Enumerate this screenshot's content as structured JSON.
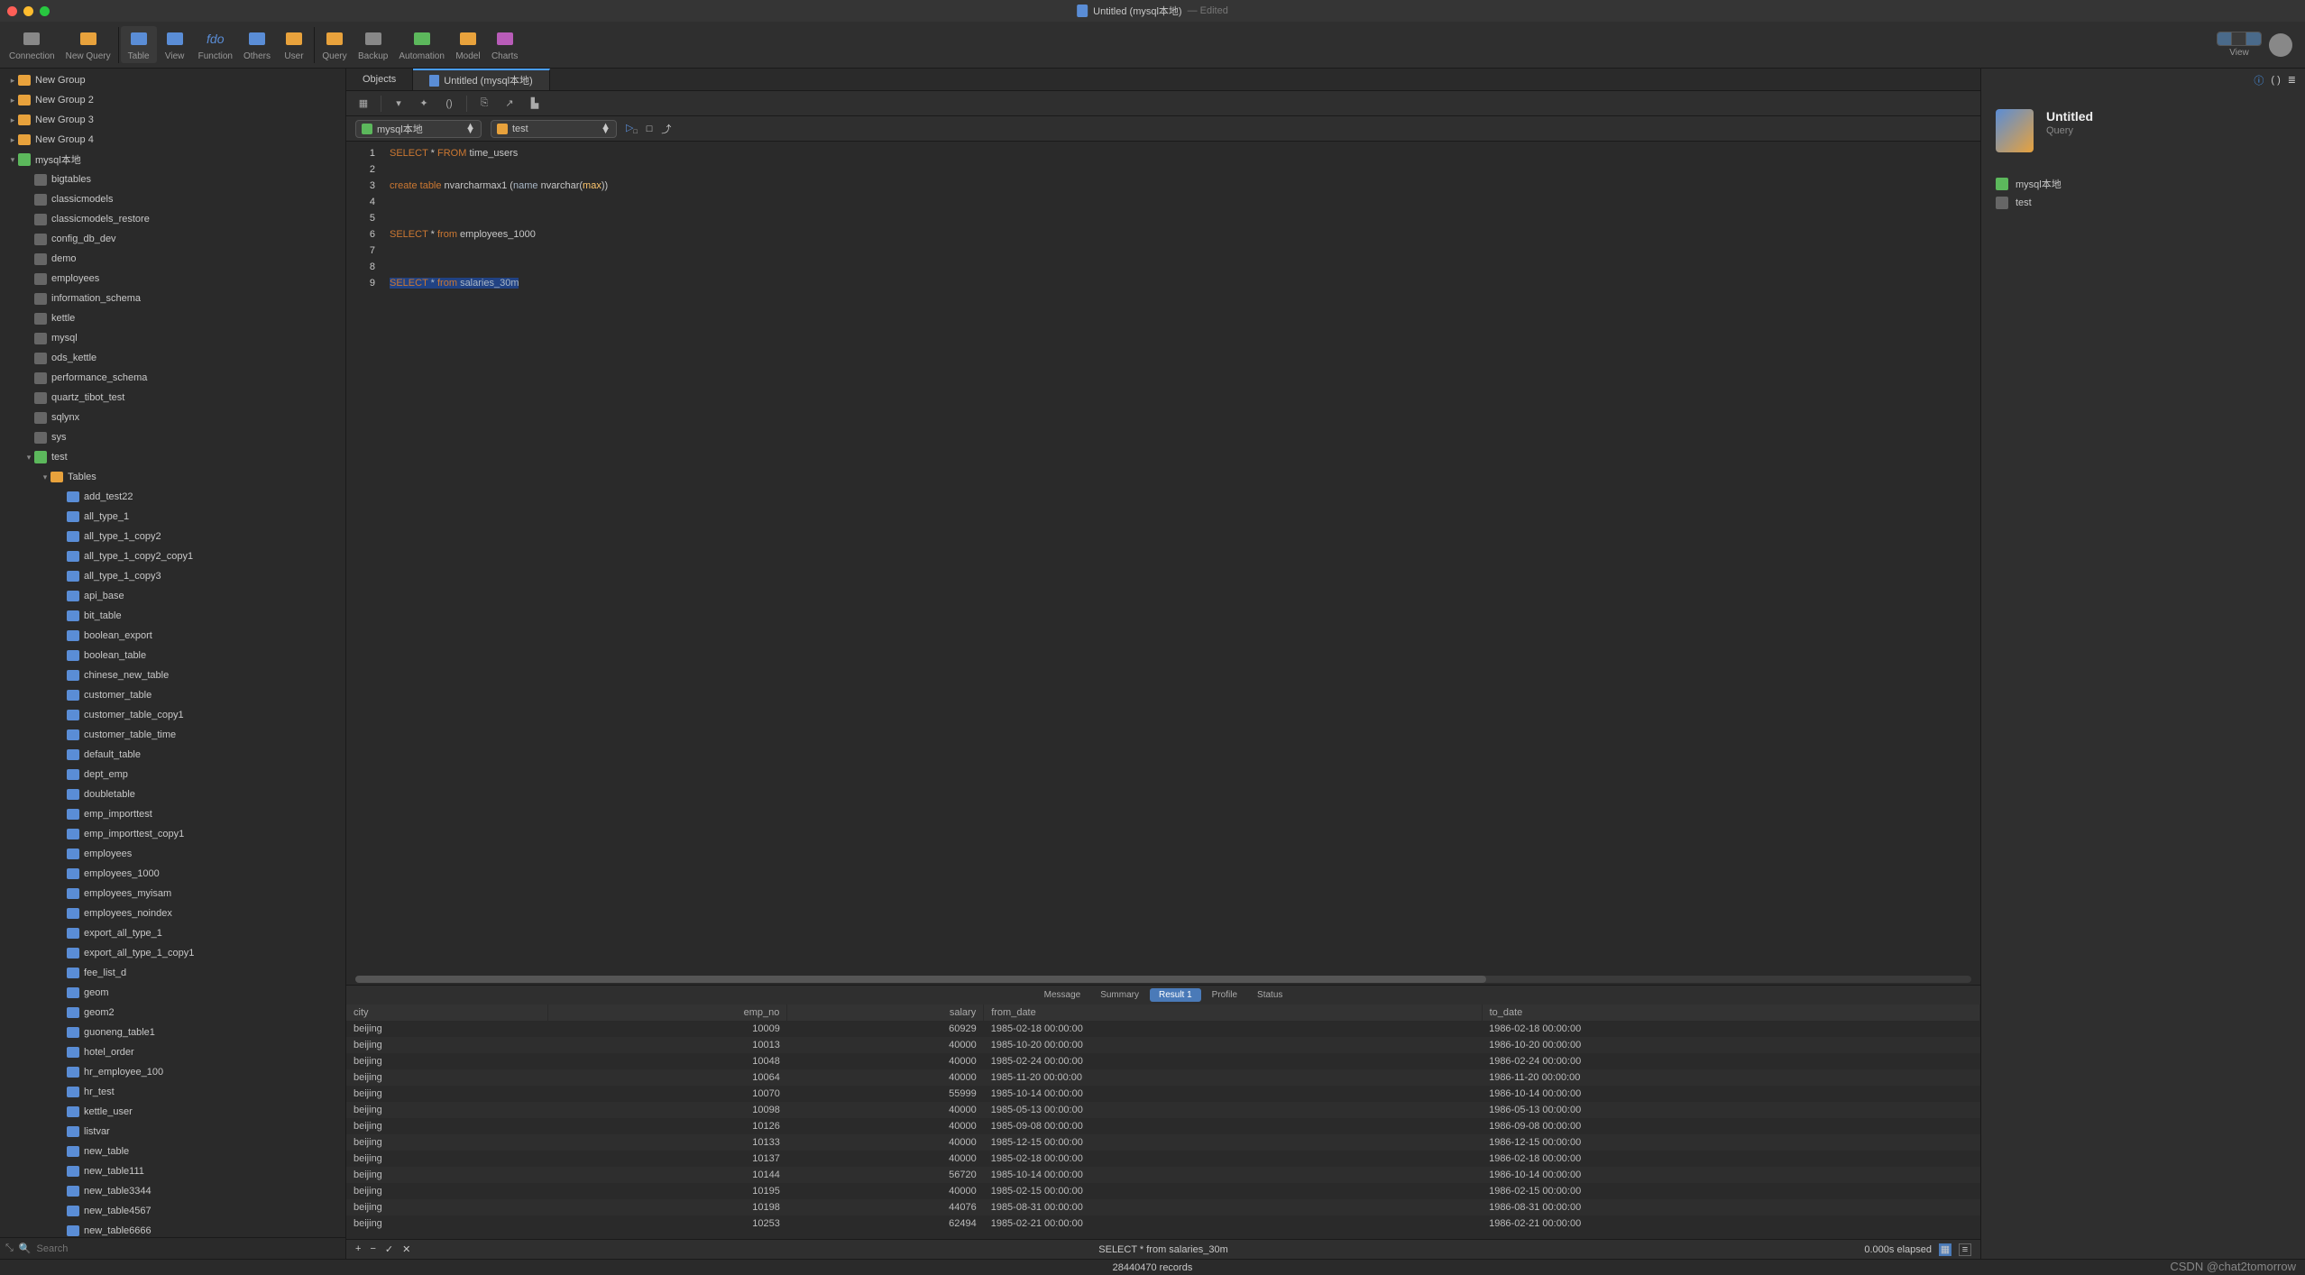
{
  "titlebar": {
    "doc_title": "Untitled (mysql本地)",
    "edited": "— Edited"
  },
  "toolbar": {
    "items": [
      {
        "id": "connection",
        "label": "Connection"
      },
      {
        "id": "new-query",
        "label": "New Query"
      },
      {
        "id": "table",
        "label": "Table",
        "active": true
      },
      {
        "id": "view",
        "label": "View"
      },
      {
        "id": "function",
        "label": "Function"
      },
      {
        "id": "others",
        "label": "Others"
      },
      {
        "id": "user",
        "label": "User"
      },
      {
        "id": "query",
        "label": "Query"
      },
      {
        "id": "backup",
        "label": "Backup"
      },
      {
        "id": "automation",
        "label": "Automation"
      },
      {
        "id": "model",
        "label": "Model"
      },
      {
        "id": "charts",
        "label": "Charts"
      }
    ],
    "view_label": "View"
  },
  "sidebar": {
    "groups": [
      {
        "label": "New Group",
        "depth": 0,
        "icon": "fold"
      },
      {
        "label": "New Group 2",
        "depth": 0,
        "icon": "fold"
      },
      {
        "label": "New Group 3",
        "depth": 0,
        "icon": "fold"
      },
      {
        "label": "New Group 4",
        "depth": 0,
        "icon": "fold"
      },
      {
        "label": "mysql本地",
        "depth": 0,
        "icon": "conn",
        "expanded": true
      },
      {
        "label": "bigtables",
        "depth": 1,
        "icon": "db"
      },
      {
        "label": "classicmodels",
        "depth": 1,
        "icon": "db"
      },
      {
        "label": "classicmodels_restore",
        "depth": 1,
        "icon": "db"
      },
      {
        "label": "config_db_dev",
        "depth": 1,
        "icon": "db"
      },
      {
        "label": "demo",
        "depth": 1,
        "icon": "db"
      },
      {
        "label": "employees",
        "depth": 1,
        "icon": "db"
      },
      {
        "label": "information_schema",
        "depth": 1,
        "icon": "db"
      },
      {
        "label": "kettle",
        "depth": 1,
        "icon": "db"
      },
      {
        "label": "mysql",
        "depth": 1,
        "icon": "db"
      },
      {
        "label": "ods_kettle",
        "depth": 1,
        "icon": "db"
      },
      {
        "label": "performance_schema",
        "depth": 1,
        "icon": "db"
      },
      {
        "label": "quartz_tibot_test",
        "depth": 1,
        "icon": "db"
      },
      {
        "label": "sqlynx",
        "depth": 1,
        "icon": "db"
      },
      {
        "label": "sys",
        "depth": 1,
        "icon": "db"
      },
      {
        "label": "test",
        "depth": 1,
        "icon": "conn",
        "expanded": true
      },
      {
        "label": "Tables",
        "depth": 2,
        "icon": "fold",
        "expanded": true
      },
      {
        "label": "add_test22",
        "depth": 3,
        "icon": "tbl"
      },
      {
        "label": "all_type_1",
        "depth": 3,
        "icon": "tbl"
      },
      {
        "label": "all_type_1_copy2",
        "depth": 3,
        "icon": "tbl"
      },
      {
        "label": "all_type_1_copy2_copy1",
        "depth": 3,
        "icon": "tbl"
      },
      {
        "label": "all_type_1_copy3",
        "depth": 3,
        "icon": "tbl"
      },
      {
        "label": "api_base",
        "depth": 3,
        "icon": "tbl"
      },
      {
        "label": "bit_table",
        "depth": 3,
        "icon": "tbl"
      },
      {
        "label": "boolean_export",
        "depth": 3,
        "icon": "tbl"
      },
      {
        "label": "boolean_table",
        "depth": 3,
        "icon": "tbl"
      },
      {
        "label": "chinese_new_table",
        "depth": 3,
        "icon": "tbl"
      },
      {
        "label": "customer_table",
        "depth": 3,
        "icon": "tbl"
      },
      {
        "label": "customer_table_copy1",
        "depth": 3,
        "icon": "tbl"
      },
      {
        "label": "customer_table_time",
        "depth": 3,
        "icon": "tbl"
      },
      {
        "label": "default_table",
        "depth": 3,
        "icon": "tbl"
      },
      {
        "label": "dept_emp",
        "depth": 3,
        "icon": "tbl"
      },
      {
        "label": "doubletable",
        "depth": 3,
        "icon": "tbl"
      },
      {
        "label": "emp_importtest",
        "depth": 3,
        "icon": "tbl"
      },
      {
        "label": "emp_importtest_copy1",
        "depth": 3,
        "icon": "tbl"
      },
      {
        "label": "employees",
        "depth": 3,
        "icon": "tbl"
      },
      {
        "label": "employees_1000",
        "depth": 3,
        "icon": "tbl"
      },
      {
        "label": "employees_myisam",
        "depth": 3,
        "icon": "tbl"
      },
      {
        "label": "employees_noindex",
        "depth": 3,
        "icon": "tbl"
      },
      {
        "label": "export_all_type_1",
        "depth": 3,
        "icon": "tbl"
      },
      {
        "label": "export_all_type_1_copy1",
        "depth": 3,
        "icon": "tbl"
      },
      {
        "label": "fee_list_d",
        "depth": 3,
        "icon": "tbl"
      },
      {
        "label": "geom",
        "depth": 3,
        "icon": "tbl"
      },
      {
        "label": "geom2",
        "depth": 3,
        "icon": "tbl"
      },
      {
        "label": "guoneng_table1",
        "depth": 3,
        "icon": "tbl"
      },
      {
        "label": "hotel_order",
        "depth": 3,
        "icon": "tbl"
      },
      {
        "label": "hr_employee_100",
        "depth": 3,
        "icon": "tbl"
      },
      {
        "label": "hr_test",
        "depth": 3,
        "icon": "tbl"
      },
      {
        "label": "kettle_user",
        "depth": 3,
        "icon": "tbl"
      },
      {
        "label": "listvar",
        "depth": 3,
        "icon": "tbl"
      },
      {
        "label": "new_table",
        "depth": 3,
        "icon": "tbl"
      },
      {
        "label": "new_table111",
        "depth": 3,
        "icon": "tbl"
      },
      {
        "label": "new_table3344",
        "depth": 3,
        "icon": "tbl"
      },
      {
        "label": "new_table4567",
        "depth": 3,
        "icon": "tbl"
      },
      {
        "label": "new_table6666",
        "depth": 3,
        "icon": "tbl"
      }
    ],
    "search_placeholder": "Search"
  },
  "tabs": [
    {
      "label": "Objects"
    },
    {
      "label": "Untitled (mysql本地)",
      "active": true,
      "icon": true
    }
  ],
  "selectors": {
    "conn": "mysql本地",
    "db": "test"
  },
  "editor": {
    "lines": [
      {
        "n": 1,
        "html": "<span class='kw'>SELECT</span> * <span class='kw'>FROM</span> time_users"
      },
      {
        "n": 2,
        "html": ""
      },
      {
        "n": 3,
        "html": "<span class='kw'>create</span> <span class='kw'>table</span> nvarcharmax1 (<span class='id'>name</span> nvarchar(<span class='fn'>max</span>))"
      },
      {
        "n": 4,
        "html": ""
      },
      {
        "n": 5,
        "html": ""
      },
      {
        "n": 6,
        "html": "<span class='kw'>SELECT</span> * <span class='kw'>from</span> employees_1000"
      },
      {
        "n": 7,
        "html": ""
      },
      {
        "n": 8,
        "html": ""
      },
      {
        "n": 9,
        "html": "<span class='hl'><span class='kw'>SELECT</span> <span style='color:#a9b7c6'>*</span> <span class='kw'>from</span> <span style='color:#a9b7c6'>salaries_30m</span></span>"
      }
    ]
  },
  "result_tabs": [
    "Message",
    "Summary",
    "Result 1",
    "Profile",
    "Status"
  ],
  "result_active": "Result 1",
  "grid": {
    "columns": [
      "city",
      "emp_no",
      "salary",
      "from_date",
      "to_date"
    ],
    "rows": [
      [
        "beijing",
        "10009",
        "60929",
        "1985-02-18 00:00:00",
        "1986-02-18 00:00:00"
      ],
      [
        "beijing",
        "10013",
        "40000",
        "1985-10-20 00:00:00",
        "1986-10-20 00:00:00"
      ],
      [
        "beijing",
        "10048",
        "40000",
        "1985-02-24 00:00:00",
        "1986-02-24 00:00:00"
      ],
      [
        "beijing",
        "10064",
        "40000",
        "1985-11-20 00:00:00",
        "1986-11-20 00:00:00"
      ],
      [
        "beijing",
        "10070",
        "55999",
        "1985-10-14 00:00:00",
        "1986-10-14 00:00:00"
      ],
      [
        "beijing",
        "10098",
        "40000",
        "1985-05-13 00:00:00",
        "1986-05-13 00:00:00"
      ],
      [
        "beijing",
        "10126",
        "40000",
        "1985-09-08 00:00:00",
        "1986-09-08 00:00:00"
      ],
      [
        "beijing",
        "10133",
        "40000",
        "1985-12-15 00:00:00",
        "1986-12-15 00:00:00"
      ],
      [
        "beijing",
        "10137",
        "40000",
        "1985-02-18 00:00:00",
        "1986-02-18 00:00:00"
      ],
      [
        "beijing",
        "10144",
        "56720",
        "1985-10-14 00:00:00",
        "1986-10-14 00:00:00"
      ],
      [
        "beijing",
        "10195",
        "40000",
        "1985-02-15 00:00:00",
        "1986-02-15 00:00:00"
      ],
      [
        "beijing",
        "10198",
        "44076",
        "1985-08-31 00:00:00",
        "1986-08-31 00:00:00"
      ],
      [
        "beijing",
        "10253",
        "62494",
        "1985-02-21 00:00:00",
        "1986-02-21 00:00:00"
      ]
    ]
  },
  "grid_foot": {
    "query": "SELECT * from salaries_30m",
    "elapsed": "0.000s elapsed"
  },
  "statusbar": {
    "records": "28440470 records"
  },
  "rightpanel": {
    "title": "Untitled",
    "sub": "Query",
    "rows": [
      {
        "icon": "conn",
        "label": "mysql本地"
      },
      {
        "icon": "db",
        "label": "test"
      }
    ]
  },
  "watermark": "CSDN @chat2tomorrow",
  "toolbar_icons": {
    "connection": {
      "fill": "#888"
    },
    "new-query": {
      "fill": "#e8a23c"
    },
    "table": {
      "fill": "#5a8dd6"
    },
    "view": {
      "fill": "#5a8dd6"
    },
    "function": {
      "fill": "#5a8dd6",
      "text": "fdo"
    },
    "others": {
      "fill": "#5a8dd6"
    },
    "user": {
      "fill": "#e8a23c"
    },
    "query": {
      "fill": "#e8a23c"
    },
    "backup": {
      "fill": "#888"
    },
    "automation": {
      "fill": "#5cb85c"
    },
    "model": {
      "fill": "#e8a23c"
    },
    "charts": {
      "fill": "#b85cb8"
    }
  }
}
